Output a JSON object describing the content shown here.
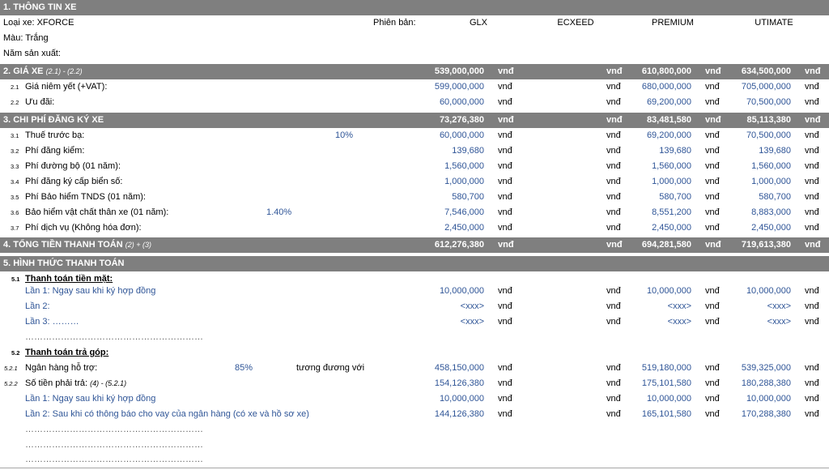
{
  "s1": {
    "title": "1. THÔNG TIN XE",
    "loai_xe": "Loại xe: XFORCE",
    "phien_ban_label": "Phiên bản:",
    "versions": [
      "GLX",
      "ECXEED",
      "PREMIUM",
      "UTIMATE"
    ],
    "mau": "Màu: Trắng",
    "nam_sx": "Năm sản xuất:"
  },
  "unit": "vnđ",
  "s2": {
    "title": "2. GIÁ XE",
    "title_note": "(2.1) - (2.2)",
    "totals": [
      "539,000,000",
      "",
      "610,800,000",
      "634,500,000"
    ],
    "rows": [
      {
        "num": "2.1",
        "label": "Giá niêm yết (+VAT):",
        "values": [
          "599,000,000",
          "",
          "680,000,000",
          "705,000,000"
        ]
      },
      {
        "num": "2.2",
        "label": "Ưu đãi:",
        "values": [
          "60,000,000",
          "",
          "69,200,000",
          "70,500,000"
        ]
      }
    ]
  },
  "s3": {
    "title": "3. CHI PHÍ ĐĂNG KÝ XE",
    "totals": [
      "73,276,380",
      "",
      "83,481,580",
      "85,113,380"
    ],
    "rows": [
      {
        "num": "3.1",
        "label": "Thuế trước bạ:",
        "rate": "10%",
        "values": [
          "60,000,000",
          "",
          "69,200,000",
          "70,500,000"
        ]
      },
      {
        "num": "3.2",
        "label": "Phí đăng kiểm:",
        "rate": "",
        "values": [
          "139,680",
          "",
          "139,680",
          "139,680"
        ]
      },
      {
        "num": "3.3",
        "label": "Phí đường bộ (01 năm):",
        "rate": "",
        "values": [
          "1,560,000",
          "",
          "1,560,000",
          "1,560,000"
        ]
      },
      {
        "num": "3.4",
        "label": "Phí đăng ký cấp biển số:",
        "rate": "",
        "values": [
          "1,000,000",
          "",
          "1,000,000",
          "1,000,000"
        ]
      },
      {
        "num": "3.5",
        "label": "Phí Bảo hiểm TNDS (01 năm):",
        "rate": "",
        "values": [
          "580,700",
          "",
          "580,700",
          "580,700"
        ]
      },
      {
        "num": "3.6",
        "label": "Bảo hiểm vật chất thân xe (01 năm):",
        "rate": "1.40%",
        "values": [
          "7,546,000",
          "",
          "8,551,200",
          "8,883,000"
        ]
      },
      {
        "num": "3.7",
        "label": "Phí dịch vụ (Không hóa đơn):",
        "rate": "",
        "values": [
          "2,450,000",
          "",
          "2,450,000",
          "2,450,000"
        ]
      }
    ]
  },
  "s4": {
    "title": "4. TỔNG TIỀN THANH TOÁN",
    "title_note": "(2) + (3)",
    "totals": [
      "612,276,380",
      "",
      "694,281,580",
      "719,613,380"
    ]
  },
  "s5": {
    "title": "5. HÌNH THỨC THANH TOÁN",
    "cash": {
      "num": "5.1",
      "label": "Thanh toán tiền mặt:",
      "rows": [
        {
          "label": "Lần 1: Ngay sau khi ký hợp đồng",
          "values": [
            "10,000,000",
            "",
            "10,000,000",
            "10,000,000"
          ]
        },
        {
          "label": "Lần 2:",
          "values": [
            "<xxx>",
            "",
            "<xxx>",
            "<xxx>"
          ]
        },
        {
          "label": "Lần 3: ………",
          "values": [
            "<xxx>",
            "",
            "<xxx>",
            "<xxx>"
          ]
        }
      ],
      "dots": "……………………………………………………"
    },
    "installment": {
      "num": "5.2",
      "label": "Thanh toán trả góp:",
      "loan": {
        "num": "5.2.1",
        "label": "Ngân hàng hỗ trợ:",
        "rate": "85%",
        "equiv": "tương đương với",
        "values": [
          "458,150,000",
          "",
          "519,180,000",
          "539,325,000"
        ]
      },
      "pay": {
        "num": "5.2.2",
        "label": "Số tiền phải trả:",
        "note": "(4) - (5.2.1)",
        "values": [
          "154,126,380",
          "",
          "175,101,580",
          "180,288,380"
        ]
      },
      "rows": [
        {
          "label": "Lần 1: Ngay sau khi ký hợp đồng",
          "values": [
            "10,000,000",
            "",
            "10,000,000",
            "10,000,000"
          ]
        },
        {
          "label": "Lần 2: Sau khi có thông báo cho vay của ngân hàng (có xe và hồ sơ xe)",
          "values": [
            "144,126,380",
            "",
            "165,101,580",
            "170,288,380"
          ]
        }
      ],
      "dots": [
        "……………………………………………………",
        "……………………………………………………",
        "……………………………………………………"
      ]
    }
  },
  "colors": {
    "header_bg": "#7f7f7f",
    "value_blue": "#2f5597",
    "grid_line": "#a6a6a6"
  }
}
